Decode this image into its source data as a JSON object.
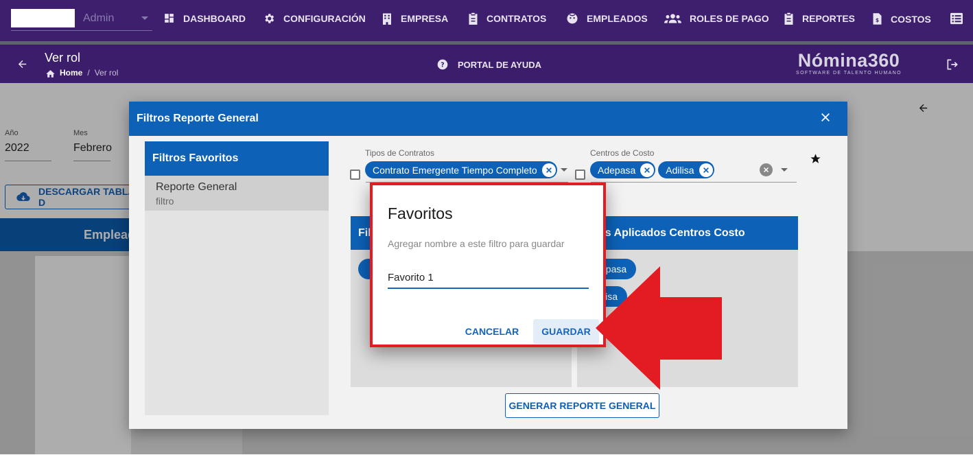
{
  "topnav": {
    "user_role": "Admin",
    "items": [
      {
        "label": "DASHBOARD",
        "icon": "dashboard-icon"
      },
      {
        "label": "CONFIGURACIÓN",
        "icon": "gear-icon"
      },
      {
        "label": "EMPRESA",
        "icon": "building-icon"
      },
      {
        "label": "CONTRATOS",
        "icon": "clipboard-icon"
      },
      {
        "label": "EMPLEADOS",
        "icon": "face-icon"
      },
      {
        "label": "ROLES DE PAGO",
        "icon": "users-icon"
      },
      {
        "label": "REPORTES",
        "icon": "clipboard-list-icon"
      },
      {
        "label": "COSTOS",
        "icon": "file-dollar-icon"
      },
      {
        "label": "",
        "icon": "list-icon"
      }
    ]
  },
  "subheader": {
    "title": "Ver rol",
    "breadcrumb": {
      "home": "Home",
      "current": "Ver rol"
    },
    "help_label": "PORTAL DE AYUDA",
    "logo_name": "Nómina360",
    "logo_tagline": "SOFTWARE DE TALENTO HUMANO"
  },
  "background": {
    "year_label": "Año",
    "year_value": "2022",
    "month_label": "Mes",
    "month_value": "Febrero",
    "download_label": "DESCARGAR TABLA D",
    "employees_header": "Emplead"
  },
  "filter_dialog": {
    "title": "Filtros Reporte General",
    "favorites_header": "Filtros Favoritos",
    "favorite_item": {
      "title": "Reporte General",
      "subtitle": "filtro"
    },
    "contract_types": {
      "label": "Tipos de Contratos",
      "chips": [
        "Contrato Emergente Tiempo Completo"
      ]
    },
    "cost_centers": {
      "label": "Centros de Costo",
      "chips": [
        "Adepasa",
        "Adilisa"
      ]
    },
    "applied_contracts_header": "Fil",
    "applied_cost_header": "os Aplicados Centros Costo",
    "applied_cost_chips": [
      "epasa",
      "lisa"
    ],
    "generate_label": "GENERAR REPORTE GENERAL"
  },
  "favoritos_dialog": {
    "title": "Favoritos",
    "prompt": "Agregar nombre a este filtro para guardar",
    "input_value": "Favorito 1",
    "cancel_label": "CANCELAR",
    "save_label": "GUARDAR"
  },
  "colors": {
    "nav_bg": "#3d1f6e",
    "primary_blue": "#0d62b8",
    "annotation_red": "#e31b23"
  }
}
